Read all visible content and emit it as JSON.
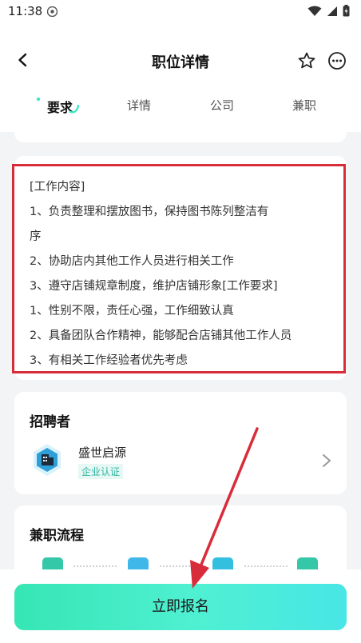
{
  "status_bar": {
    "time": "11:38"
  },
  "header": {
    "title": "职位详情"
  },
  "tabs": [
    {
      "label": "要求",
      "active": true
    },
    {
      "label": "详情",
      "active": false
    },
    {
      "label": "公司",
      "active": false
    },
    {
      "label": "兼职",
      "active": false
    }
  ],
  "description": {
    "lines": [
      "[工作内容]",
      "1、负责整理和摆放图书，保持图书陈列整洁有",
      "序",
      "2、协助店内其他工作人员进行相关工作",
      "3、遵守店铺规章制度，维护店铺形象[工作要求]",
      "1、性别不限，责任心强，工作细致认真",
      "2、具备团队合作精神，能够配合店铺其他工作人员",
      "3、有相关工作经验者优先考虑"
    ]
  },
  "recruiter": {
    "section_title": "招聘者",
    "company_name": "盛世启源",
    "badge": "企业认证"
  },
  "process": {
    "section_title": "兼职流程"
  },
  "actions": {
    "apply_label": "立即报名"
  },
  "colors": {
    "accent": "#3ee8c4",
    "highlight_border": "#d92c3b",
    "badge_text": "#2bb5a0"
  },
  "icons": {
    "back": "chevron-left-icon",
    "favorite": "star-outline-icon",
    "more": "more-horizontal-icon",
    "company": "building-icon",
    "next": "chevron-right-icon"
  }
}
